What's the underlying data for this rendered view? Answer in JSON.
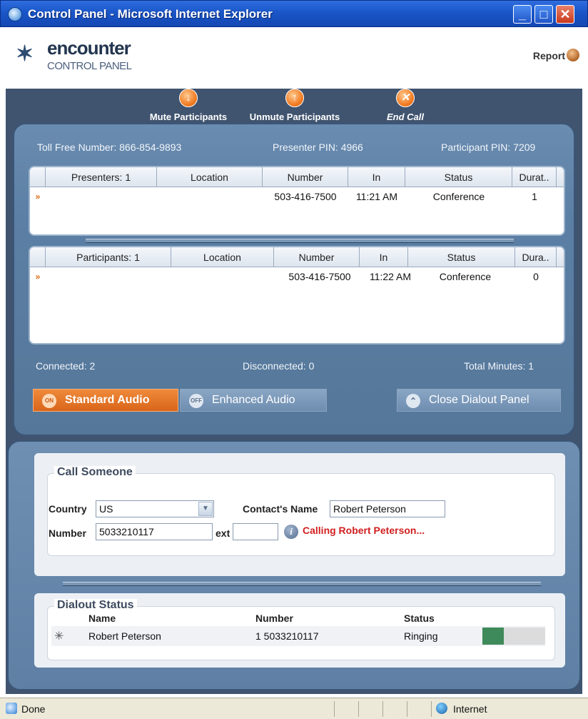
{
  "window": {
    "title": "Control Panel - Microsoft Internet Explorer",
    "buttons": {
      "minimize": "_",
      "maximize": "□",
      "close": "✕"
    }
  },
  "header": {
    "logo_word": "encounter",
    "logo_sub": "CONTROL PANEL",
    "report_label": "Report"
  },
  "toolbar": {
    "mute": "Mute Participants",
    "unmute": "Unmute Participants",
    "end": "End Call"
  },
  "info": {
    "toll_free": "Toll Free Number: 866-854-9893",
    "presenter_pin": "Presenter PIN: 4966",
    "participant_pin": "Participant PIN: 7209"
  },
  "presenters": {
    "columns": [
      "Presenters: 1",
      "Location",
      "Number",
      "In",
      "Status",
      "Durat.."
    ],
    "rows": [
      {
        "location": "",
        "number": "503-416-7500",
        "in": "11:21 AM",
        "status": "Conference",
        "duration": "1"
      }
    ]
  },
  "participants": {
    "columns": [
      "Participants: 1",
      "Location",
      "Number",
      "In",
      "Status",
      "Dura.."
    ],
    "rows": [
      {
        "location": "",
        "number": "503-416-7500",
        "in": "11:22 AM",
        "status": "Conference",
        "duration": "0"
      }
    ]
  },
  "summary": {
    "connected": "Connected: 2",
    "disconnected": "Disconnected: 0",
    "total_minutes": "Total Minutes: 1"
  },
  "audio": {
    "standard": "Standard Audio",
    "enhanced": "Enhanced Audio",
    "on_badge": "ON",
    "off_badge": "OFF",
    "close_dialout": "Close Dialout Panel"
  },
  "call_someone": {
    "legend": "Call Someone",
    "country_label": "Country",
    "country_value": "US",
    "contact_label": "Contact's Name",
    "contact_value": "Robert Peterson",
    "number_label": "Number",
    "number_value": "5033210117",
    "ext_label": "ext",
    "ext_value": "",
    "status_msg": "Calling Robert Peterson..."
  },
  "dialout": {
    "legend": "Dialout Status",
    "headers": {
      "name": "Name",
      "number": "Number",
      "status": "Status"
    },
    "rows": [
      {
        "name": "Robert Peterson",
        "number": "1 5033210117",
        "status": "Ringing"
      }
    ]
  },
  "statusbar": {
    "left": "Done",
    "zone": "Internet"
  },
  "colors": {
    "accent_orange": "#f0781e",
    "calling_red": "#d11f1f",
    "frame_blue": "#40546f",
    "progress_green": "#3f8a5a"
  },
  "icons": [
    "ie-icon",
    "report-icon",
    "mute-icon",
    "unmute-icon",
    "end-call-icon",
    "info-icon",
    "spinner-icon",
    "globe-icon"
  ]
}
